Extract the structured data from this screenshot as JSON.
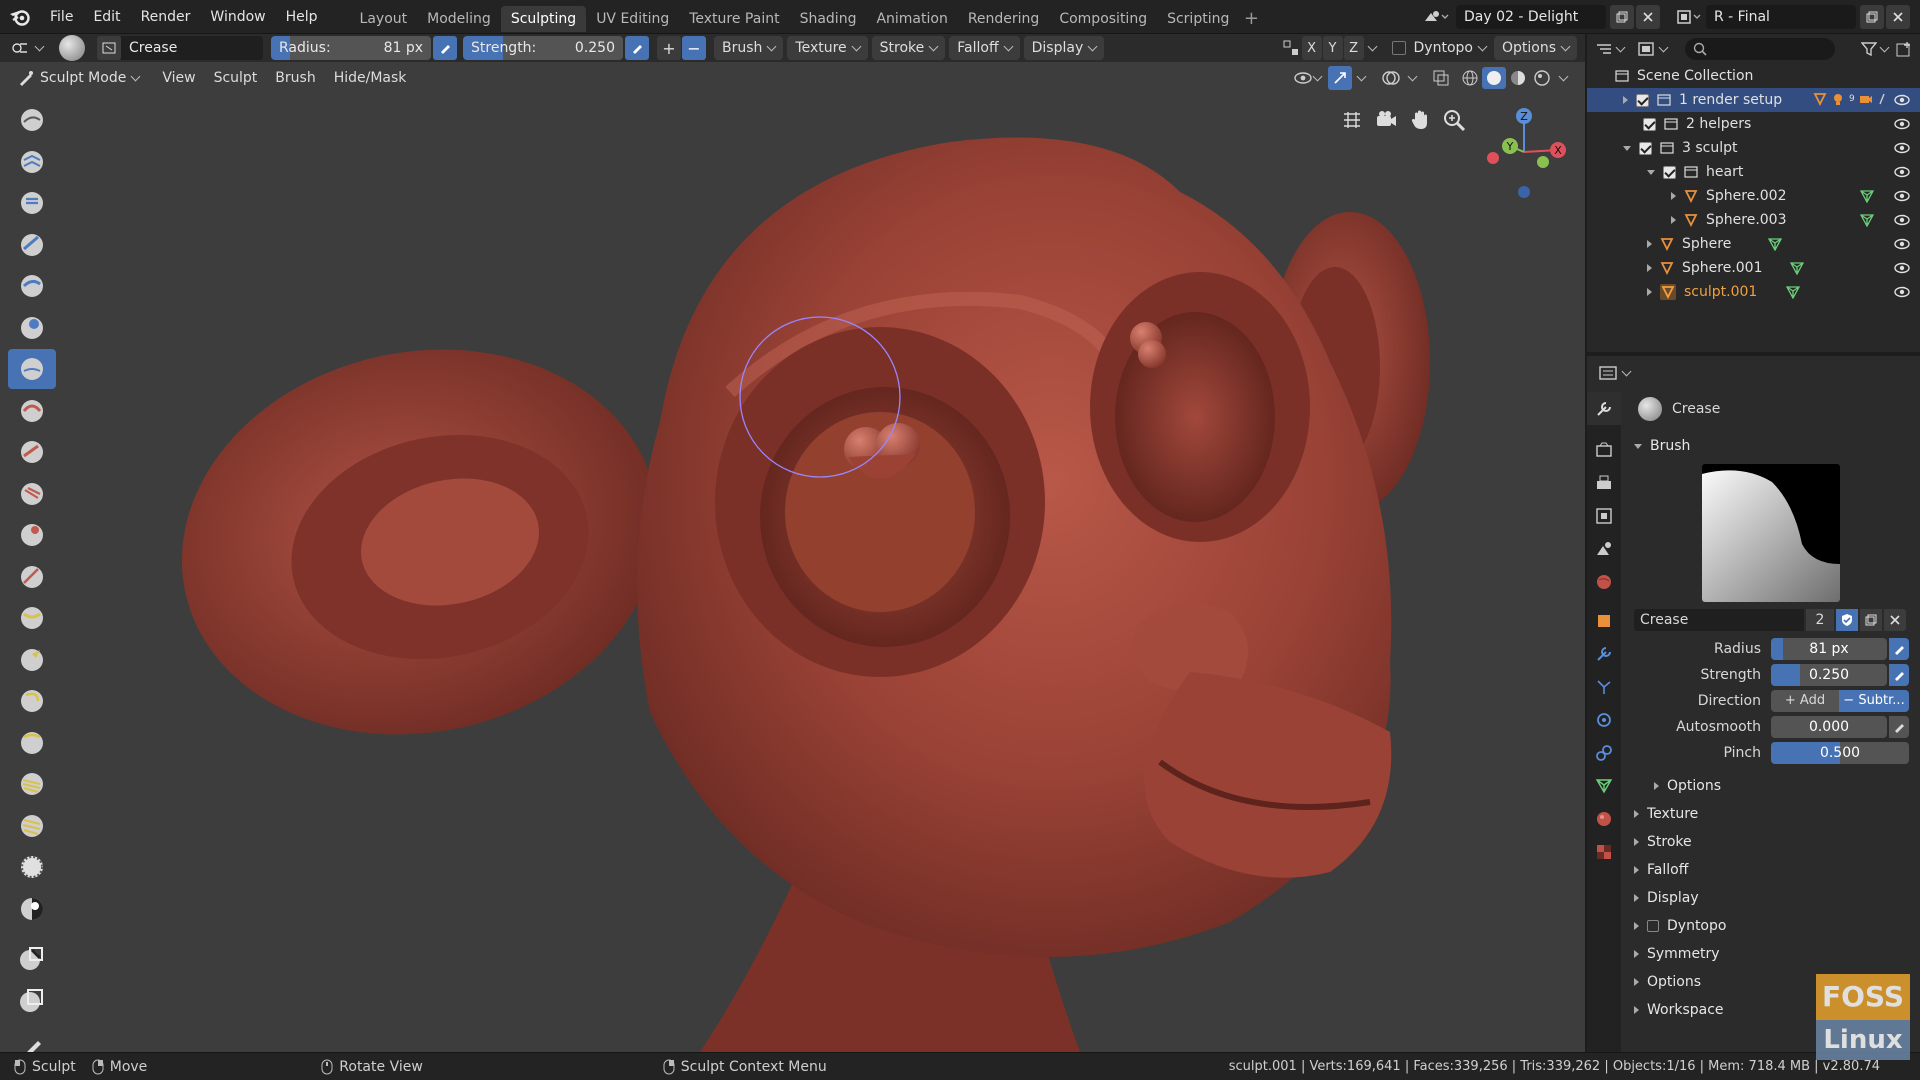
{
  "menubar": {
    "items": [
      "File",
      "Edit",
      "Render",
      "Window",
      "Help"
    ],
    "workspace_tabs": [
      "Layout",
      "Modeling",
      "Sculpting",
      "UV Editing",
      "Texture Paint",
      "Shading",
      "Animation",
      "Rendering",
      "Compositing",
      "Scripting"
    ],
    "active_tab": "Sculpting",
    "add_tab": "+",
    "scene": "Day 02 - Delight",
    "view_layer": "R - Final"
  },
  "tool_header": {
    "brush_name": "Crease",
    "radius_label": "Radius:",
    "radius_value": "81 px",
    "strength_label": "Strength:",
    "strength_value": "0.250",
    "plus": "+",
    "minus": "−",
    "dropdowns": [
      "Brush",
      "Texture",
      "Stroke",
      "Falloff",
      "Display"
    ],
    "axes": [
      "X",
      "Y",
      "Z"
    ],
    "dyntopo": "Dyntopo",
    "options": "Options"
  },
  "viewport_header": {
    "mode": "Sculpt Mode",
    "menus": [
      "View",
      "Sculpt",
      "Brush",
      "Hide/Mask"
    ]
  },
  "gizmo": {
    "x": "X",
    "y": "Y",
    "z": "Z"
  },
  "toolbar": {
    "tools": [
      "draw",
      "draw-sharp",
      "clay",
      "clay-strips",
      "layer",
      "inflate",
      "blob",
      "crease",
      "smooth",
      "flatten",
      "fill",
      "scrape",
      "pinch",
      "grab",
      "snake-hook",
      "thumb",
      "nudge",
      "rotate",
      "simplify",
      "mask",
      "box-hide",
      "box-mask",
      "annotate"
    ],
    "active": "crease"
  },
  "outliner": {
    "root": "Scene Collection",
    "rows": [
      {
        "label": "1 render setup",
        "depth": 1
      },
      {
        "label": "2 helpers",
        "depth": 1
      },
      {
        "label": "3 sculpt",
        "depth": 1
      },
      {
        "label": "heart",
        "depth": 2
      },
      {
        "label": "Sphere.002",
        "depth": 3
      },
      {
        "label": "Sphere.003",
        "depth": 3
      },
      {
        "label": "Sphere",
        "depth": 2
      },
      {
        "label": "Sphere.001",
        "depth": 2
      },
      {
        "label": "sculpt.001",
        "depth": 2
      }
    ],
    "render_setup_count": "9",
    "active_object_color": "#f0a040"
  },
  "properties": {
    "title": "Crease",
    "brush_panel": "Brush",
    "brush_name": "Crease",
    "users": "2",
    "radius_label": "Radius",
    "radius_value": "81 px",
    "strength_label": "Strength",
    "strength_value": "0.250",
    "direction_label": "Direction",
    "add_label": "Add",
    "subtract_label": "Subtr...",
    "autosmooth_label": "Autosmooth",
    "autosmooth_value": "0.000",
    "pinch_label": "Pinch",
    "pinch_value": "0.500",
    "pinch_fraction": 0.5,
    "strength_fraction": 0.25,
    "radius_fraction": 0.1,
    "options_sub": "Options",
    "panels": [
      "Texture",
      "Stroke",
      "Falloff",
      "Display",
      "Dyntopo",
      "Symmetry",
      "Options",
      "Workspace"
    ]
  },
  "statusbar": {
    "left": [
      "Sculpt",
      "Move",
      "Rotate View",
      "Sculpt Context Menu"
    ],
    "stats": "sculpt.001 | Verts:169,641 | Faces:339,256 | Tris:339,262 | Objects:1/16 | Mem: 718.4 MB | v2.80.74"
  },
  "watermark": {
    "line1": "FOSS",
    "line2": "Linux"
  },
  "colors": {
    "accent": "#4772b3",
    "selection": "#334d80",
    "model": "#9a4236"
  }
}
